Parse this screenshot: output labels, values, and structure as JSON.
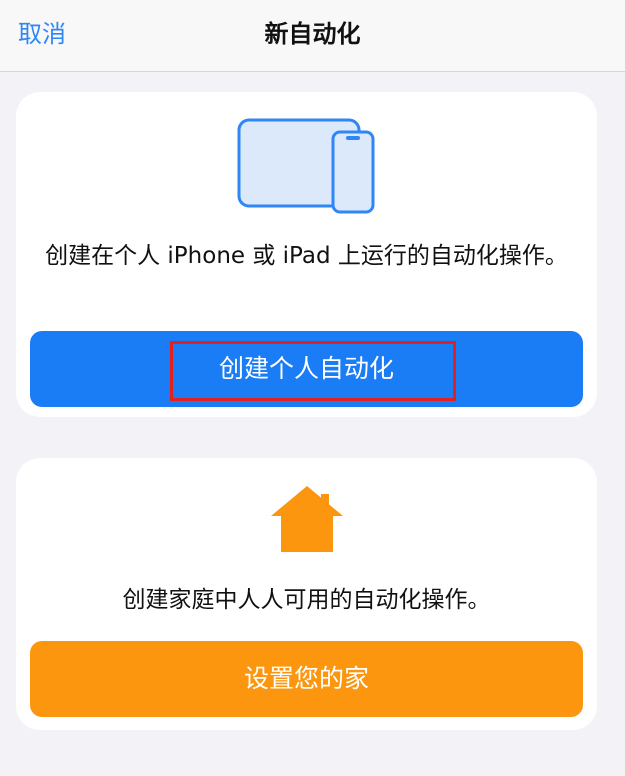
{
  "nav": {
    "cancel_label": "取消",
    "title": "新自动化"
  },
  "personal_card": {
    "icon": "iphone-ipad-icon",
    "description": "创建在个人 iPhone 或 iPad 上运行的自动化操作。",
    "button_label": "创建个人自动化",
    "button_color": "#1a7df6",
    "highlight_color": "#e0211e"
  },
  "home_card": {
    "icon": "house-icon",
    "description": "创建家庭中人人可用的自动化操作。",
    "button_label": "设置您的家",
    "button_color": "#fb960e"
  },
  "colors": {
    "accent": "#2f86f6",
    "background": "#f2f2f7",
    "card": "#ffffff"
  }
}
